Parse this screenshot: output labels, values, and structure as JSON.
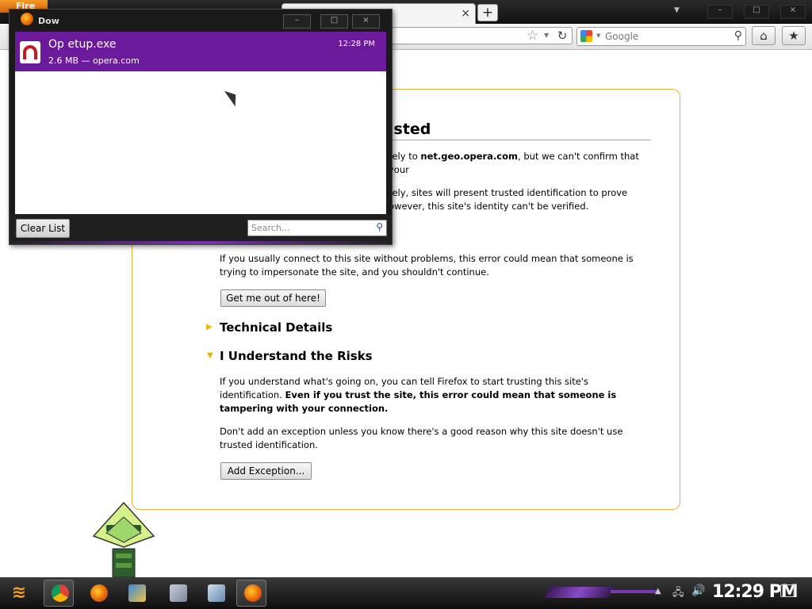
{
  "browser": {
    "firefox_tab_label": "Fire",
    "tab_close": "×",
    "new_tab": "+",
    "tab_list_arrow": "▼",
    "window_controls": [
      "–",
      "□",
      "×"
    ],
    "search_placeholder": "Google",
    "search_engine": "google-icon",
    "bookmark_star": "☆",
    "reload": "↻",
    "home": "⌂",
    "bookmarks": "★"
  },
  "error_page": {
    "title_visible": "usted",
    "intro_prefix": "rely to ",
    "intro_host": "net.geo.opera.com",
    "intro_suffix": ", but we can't confirm that your",
    "normally_line1": "rely, sites will present trusted identification to prove",
    "normally_line2": "owever, this site's identity can't be verified.",
    "usually_text": "If you usually connect to this site without problems, this error could mean that someone is trying to impersonate the site, and you shouldn't continue.",
    "get_out_button": "Get me out of here!",
    "technical_details": "Technical Details",
    "understand_risks": "I Understand the Risks",
    "understand_text_plain": "If you understand what's going on, you can tell Firefox to start trusting this site's identification. ",
    "understand_text_bold": "Even if you trust the site, this error could mean that someone is tampering with your connection.",
    "dont_text": "Don't add an exception unless you know there's a good reason why this site doesn't use trusted identification.",
    "add_exception_button": "Add Exception..."
  },
  "downloads": {
    "title": "Dow",
    "controls": [
      "–",
      "□",
      "×"
    ],
    "item": {
      "name": "Op    etup.exe",
      "meta": "2.6 MB — opera.com",
      "time": "12:28 PM"
    },
    "clear_list": "Clear List",
    "search_placeholder": "Search..."
  },
  "taskbar": {
    "clock": "12:29 PM",
    "tray_arrow": "▲",
    "apps": [
      "chrome-icon",
      "firefox-icon",
      "media-icon",
      "folder-icon",
      "installer-icon",
      "network-icon",
      "firefox-icon"
    ]
  },
  "colors": {
    "download_highlight": "#6a1a9a",
    "error_border": "#e2b23b",
    "expander_arrow": "#e6b800"
  }
}
